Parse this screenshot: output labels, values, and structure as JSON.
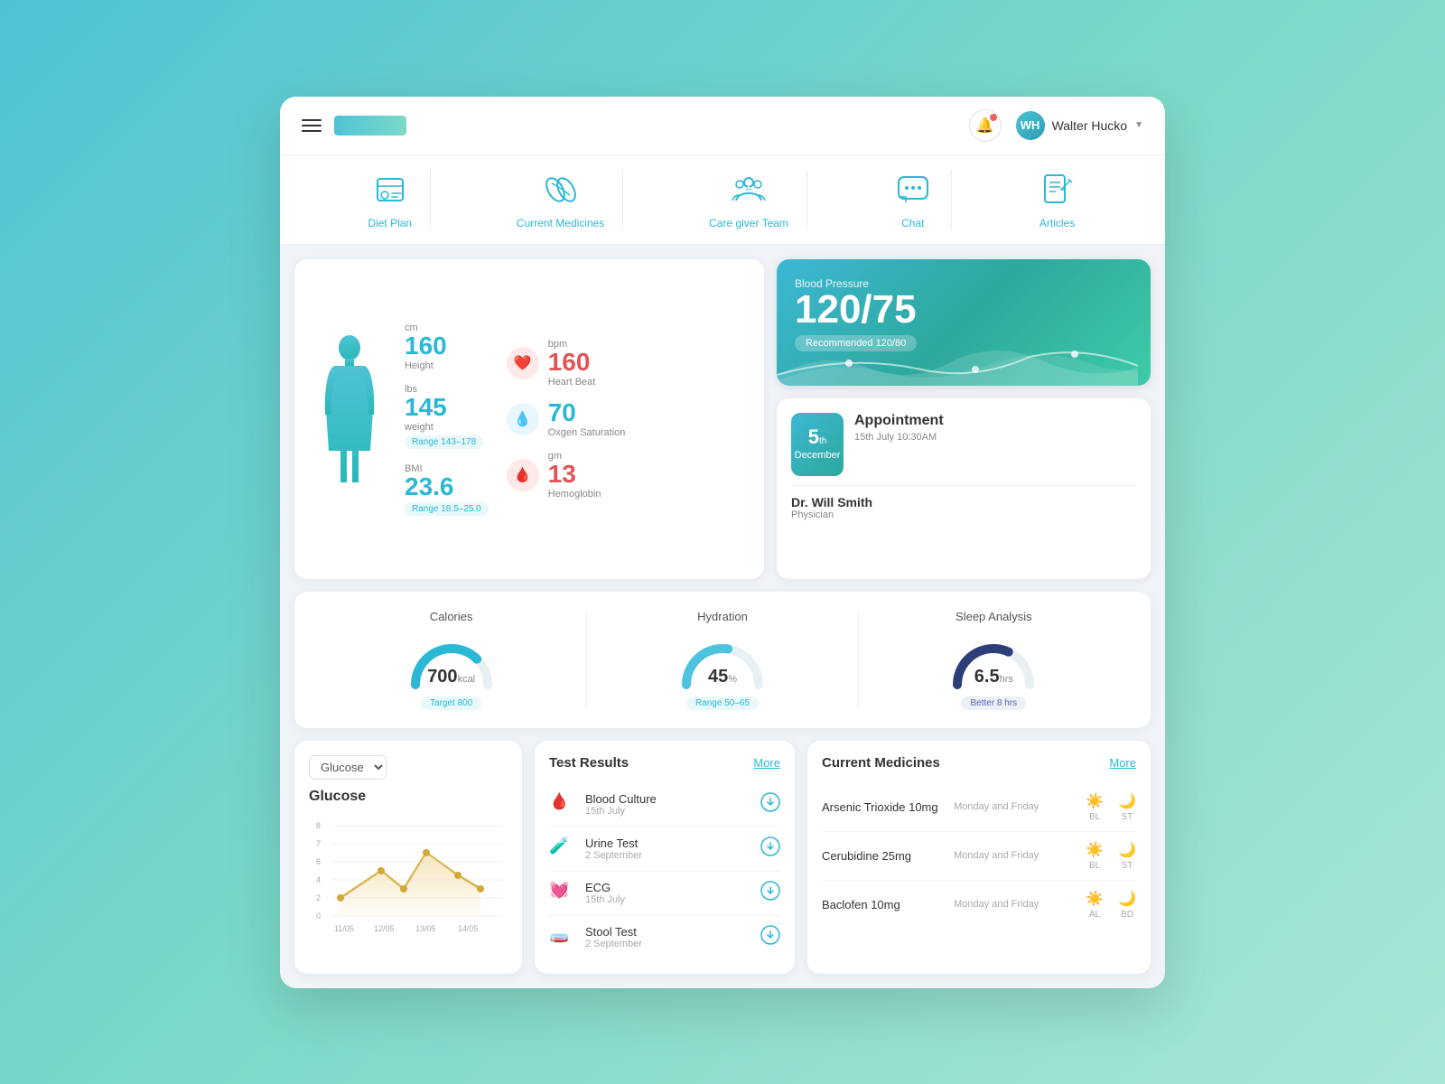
{
  "header": {
    "logo_alt": "Logo",
    "user_name": "Walter Hucko",
    "user_initials": "WH"
  },
  "nav": {
    "items": [
      {
        "id": "diet-plan",
        "label": "Diet Plan",
        "icon": "🍽"
      },
      {
        "id": "current-medicines",
        "label": "Current Medicines",
        "icon": "💊"
      },
      {
        "id": "care-giver-team",
        "label": "Care giver Team",
        "icon": "👥"
      },
      {
        "id": "chat",
        "label": "Chat",
        "icon": "💬"
      },
      {
        "id": "articles",
        "label": "Articles",
        "icon": "📄"
      }
    ]
  },
  "body_stats": {
    "height": {
      "value": "160",
      "unit": "cm",
      "label": "Height"
    },
    "weight": {
      "value": "145",
      "unit": "lbs",
      "label": "weight",
      "range": "Range 143–178"
    },
    "bmi": {
      "value": "23.6",
      "label": "BMI",
      "range": "Range 18.5–25.0"
    },
    "heart_beat": {
      "value": "160",
      "unit": "bpm",
      "label": "Heart Beat"
    },
    "oxygen": {
      "value": "70",
      "label": "Oxgen Saturation"
    },
    "hemoglobin": {
      "value": "13",
      "unit": "gm",
      "label": "Hemoglobin"
    }
  },
  "blood_pressure": {
    "label": "Blood Pressure",
    "value": "120/75",
    "recommended": "Recommended 120/80"
  },
  "appointment": {
    "title": "Appointment",
    "date_day": "5",
    "date_sup": "th",
    "date_month": "December",
    "time": "15th July 10:30AM",
    "doctor": "Dr. Will Smith",
    "role": "Physician"
  },
  "vitals": {
    "calories": {
      "title": "Calories",
      "value": "700",
      "unit": "kcal",
      "target": "Target 800"
    },
    "hydration": {
      "title": "Hydration",
      "value": "45",
      "unit": "%",
      "range": "Range 50–65"
    },
    "sleep": {
      "title": "Sleep Analysis",
      "value": "6.5",
      "unit": "hrs",
      "note": "Better 8 hrs"
    }
  },
  "glucose": {
    "title": "Glucose",
    "dropdown_label": "Glucose",
    "x_labels": [
      "11/05",
      "12/05",
      "13/05",
      "14/05"
    ],
    "y_labels": [
      "0",
      "2",
      "4",
      "6",
      "7",
      "8"
    ],
    "data_points": [
      2.5,
      4.0,
      3.0,
      5.5,
      3.5,
      2.8
    ]
  },
  "test_results": {
    "title": "Test Results",
    "more_label": "More",
    "items": [
      {
        "name": "Blood Culture",
        "date": "15th July",
        "icon": "🩸"
      },
      {
        "name": "Urine Test",
        "date": "2 September",
        "icon": "🧪"
      },
      {
        "name": "ECG",
        "date": "15th July",
        "icon": "💓"
      },
      {
        "name": "Stool Test",
        "date": "2 September",
        "icon": "🧫"
      }
    ]
  },
  "medicines": {
    "title": "Current Medicines",
    "more_label": "More",
    "items": [
      {
        "name": "Arsenic Trioxide 10mg",
        "schedule": "Monday and Friday",
        "times": [
          {
            "icon": "☀️",
            "label": "BL"
          },
          {
            "icon": "🌙",
            "label": "ST"
          }
        ]
      },
      {
        "name": "Cerubidine 25mg",
        "schedule": "Monday and Friday",
        "times": [
          {
            "icon": "☀️",
            "label": "BL"
          },
          {
            "icon": "🌙",
            "label": "ST"
          }
        ]
      },
      {
        "name": "Baclofen 10mg",
        "schedule": "Monday and Friday",
        "times": [
          {
            "icon": "☀️",
            "label": "AL"
          },
          {
            "icon": "🌙",
            "label": "BD"
          }
        ]
      }
    ]
  }
}
